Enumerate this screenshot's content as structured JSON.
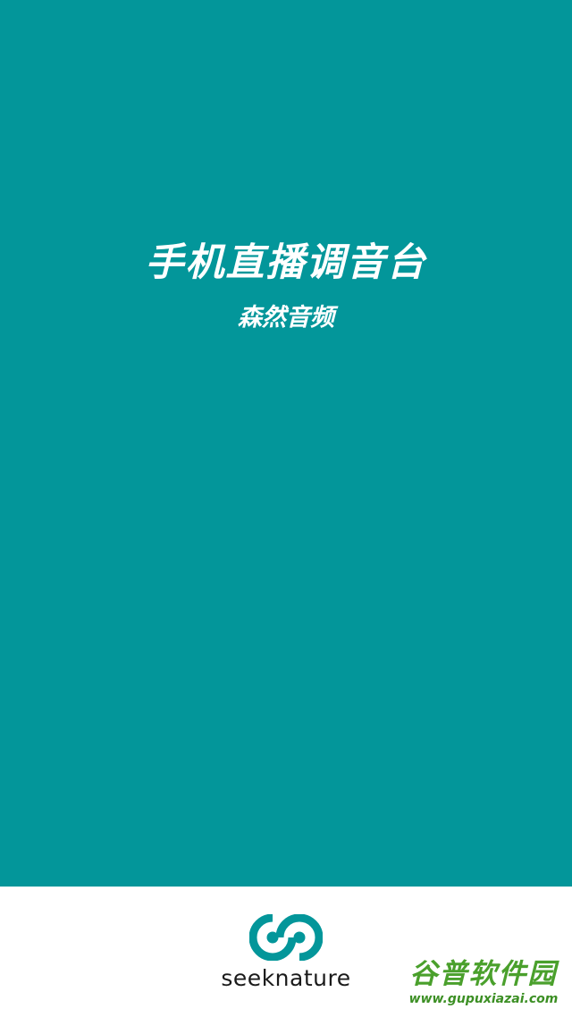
{
  "splash": {
    "title": "手机直播调音台",
    "subtitle": "森然音频",
    "background_color": "#03969A"
  },
  "footer": {
    "logo_icon": "seeknature-logo-icon",
    "brand_name": "seeknature"
  },
  "watermark": {
    "title": "谷普软件园",
    "url": "www.gupuxiazai.com"
  }
}
